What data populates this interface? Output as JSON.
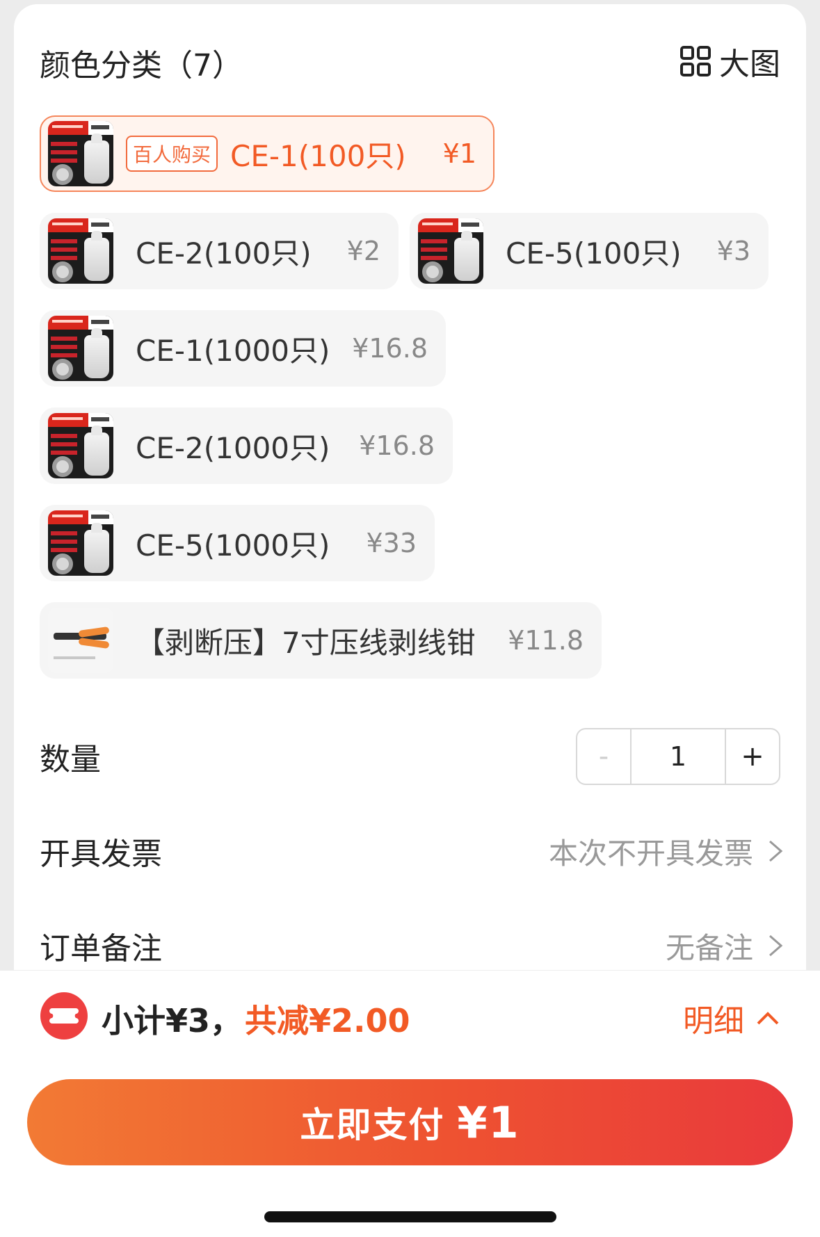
{
  "section": {
    "title": "颜色分类（7）",
    "big_view_label": "大图"
  },
  "options": [
    {
      "badge": "百人购买",
      "name": "CE-1(100只)",
      "price": "¥1",
      "selected": true
    },
    {
      "name": "CE-2(100只)",
      "price": "¥2"
    },
    {
      "name": "CE-5(100只)",
      "price": "¥3"
    },
    {
      "name": "CE-1(1000只)",
      "price": "¥16.8"
    },
    {
      "name": "CE-2(1000只)",
      "price": "¥16.8"
    },
    {
      "name": "CE-5(1000只)",
      "price": "¥33"
    },
    {
      "name": "【剥断压】7寸压线剥线钳",
      "price": "¥11.8"
    }
  ],
  "quantity": {
    "label": "数量",
    "minus": "-",
    "value": "1",
    "plus": "+"
  },
  "invoice": {
    "label": "开具发票",
    "value": "本次不开具发票"
  },
  "note": {
    "label": "订单备注",
    "value": "无备注"
  },
  "summary": {
    "subtotal": "小计¥3，",
    "discount": "共减¥2.00",
    "detail_label": "明细"
  },
  "pay": {
    "label": "立即支付",
    "amount": "¥1"
  },
  "colors": {
    "accent": "#f25a25",
    "selected_bg": "#fff4ee",
    "option_bg": "#f5f5f5"
  },
  "icons": {
    "grid": "grid-view-icon",
    "chevron": "chevron-right-icon",
    "coupon": "coupon-icon",
    "chevron_up": "chevron-up-icon"
  }
}
